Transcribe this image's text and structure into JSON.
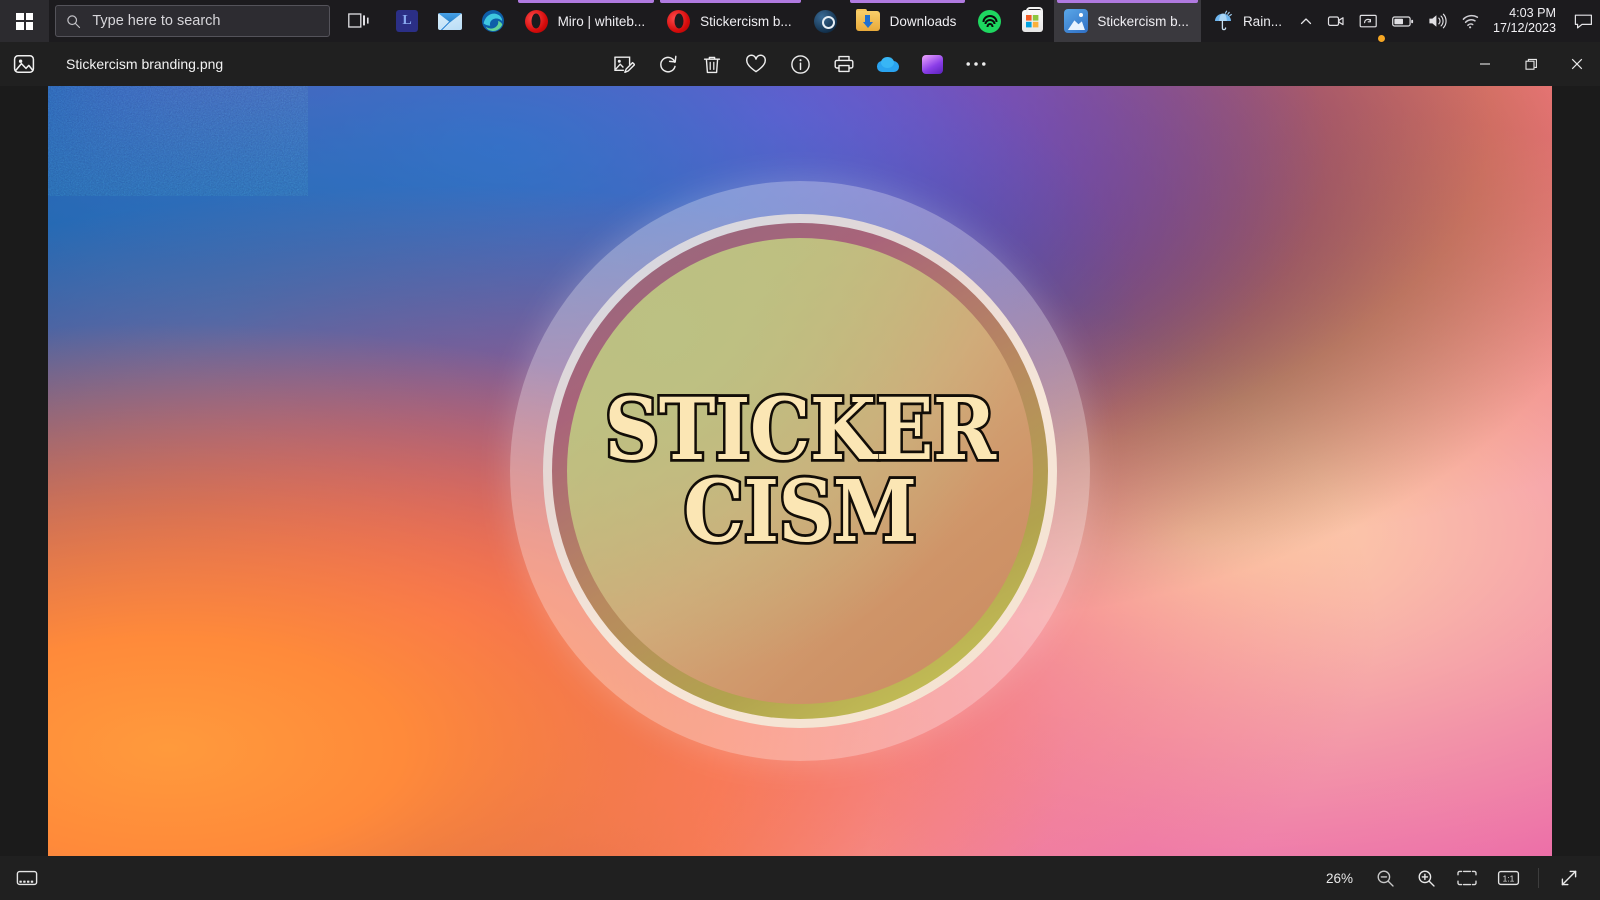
{
  "taskbar": {
    "start_label": "Start",
    "search": {
      "placeholder": "Type here to search",
      "icon": "search-icon"
    },
    "task_view_label": "Task view",
    "items": [
      {
        "name": "lastpass",
        "label": "",
        "icon": "lastpass-icon",
        "active": false,
        "running": false,
        "glyph": "L"
      },
      {
        "name": "mail",
        "label": "",
        "icon": "mail-icon",
        "active": false,
        "running": false
      },
      {
        "name": "edge",
        "label": "",
        "icon": "edge-icon",
        "active": false,
        "running": false
      },
      {
        "name": "opera-miro",
        "label": "Miro | whiteb...",
        "icon": "opera-icon",
        "active": false,
        "running": true
      },
      {
        "name": "opera-stickercism",
        "label": "Stickercism b...",
        "icon": "opera-icon",
        "active": false,
        "running": true
      },
      {
        "name": "steam",
        "label": "",
        "icon": "steam-icon",
        "active": false,
        "running": false
      },
      {
        "name": "downloads",
        "label": "Downloads",
        "icon": "folder-download-icon",
        "active": false,
        "running": true
      },
      {
        "name": "spotify",
        "label": "",
        "icon": "spotify-icon",
        "active": false,
        "running": false
      },
      {
        "name": "microsoft-store",
        "label": "",
        "icon": "store-icon",
        "active": false,
        "running": false
      },
      {
        "name": "photos",
        "label": "Stickercism b...",
        "icon": "photos-icon",
        "active": true,
        "running": true
      }
    ],
    "tray": {
      "weather": {
        "label": "Rain...",
        "icon": "umbrella-rain-icon"
      },
      "chevron_label": "Show hidden icons",
      "icons": [
        "camera-icon",
        "onedrive-sync-icon",
        "battery-icon",
        "volume-icon",
        "wifi-icon"
      ],
      "time": "4:03 PM",
      "date": "17/12/2023",
      "action_center_label": "Notifications"
    },
    "active_indicator_color": "#b07ae0"
  },
  "window": {
    "app_icon": "photo-app-icon",
    "filename": "Stickercism branding.png",
    "toolbar": [
      {
        "name": "edit-image",
        "icon": "edit-image-icon",
        "label": "Edit image"
      },
      {
        "name": "rotate",
        "icon": "rotate-icon",
        "label": "Rotate"
      },
      {
        "name": "delete",
        "icon": "trash-icon",
        "label": "Delete"
      },
      {
        "name": "favorite",
        "icon": "heart-icon",
        "label": "Add to favorites"
      },
      {
        "name": "file-info",
        "icon": "info-icon",
        "label": "File info"
      },
      {
        "name": "print",
        "icon": "printer-icon",
        "label": "Print"
      },
      {
        "name": "onedrive",
        "icon": "onedrive-icon",
        "label": "OneDrive"
      },
      {
        "name": "clipchamp",
        "icon": "clipchamp-icon",
        "label": "Edit with Clipchamp"
      },
      {
        "name": "see-more",
        "icon": "ellipsis-icon",
        "label": "See more"
      }
    ],
    "controls": {
      "minimize": "Minimize",
      "restore": "Restore",
      "close": "Close"
    }
  },
  "image": {
    "alt": "Stickercism circular badge logo on grainy rainbow gradient",
    "logo_line1": "STICKER",
    "logo_line2": "CISM",
    "logo_text_color": "#fbe6b4",
    "logo_outline_color": "#120d07",
    "palette": {
      "blue": "#1b73b8",
      "purple": "#a23bd6",
      "indigo": "#4f6fd6",
      "dark_teal": "#0f2b3f",
      "magenta": "#ef4d72",
      "orange": "#ff9a3c",
      "cream": "#ffd6a5",
      "pink": "#ec62b0",
      "badge_ring": "#b2a34e",
      "badge_disc": "#c2bd7e",
      "badge_disc_warm": "#cf9468"
    }
  },
  "statusbar": {
    "gallery_label": "Film strip",
    "gallery_icon": "filmstrip-icon",
    "zoom_level": "26%",
    "zoom_out_label": "Zoom out",
    "zoom_in_label": "Zoom in",
    "fit_label": "Fit to window",
    "actual_size_label": "Actual size",
    "actual_size_text": "1:1",
    "fullscreen_label": "Full screen"
  }
}
